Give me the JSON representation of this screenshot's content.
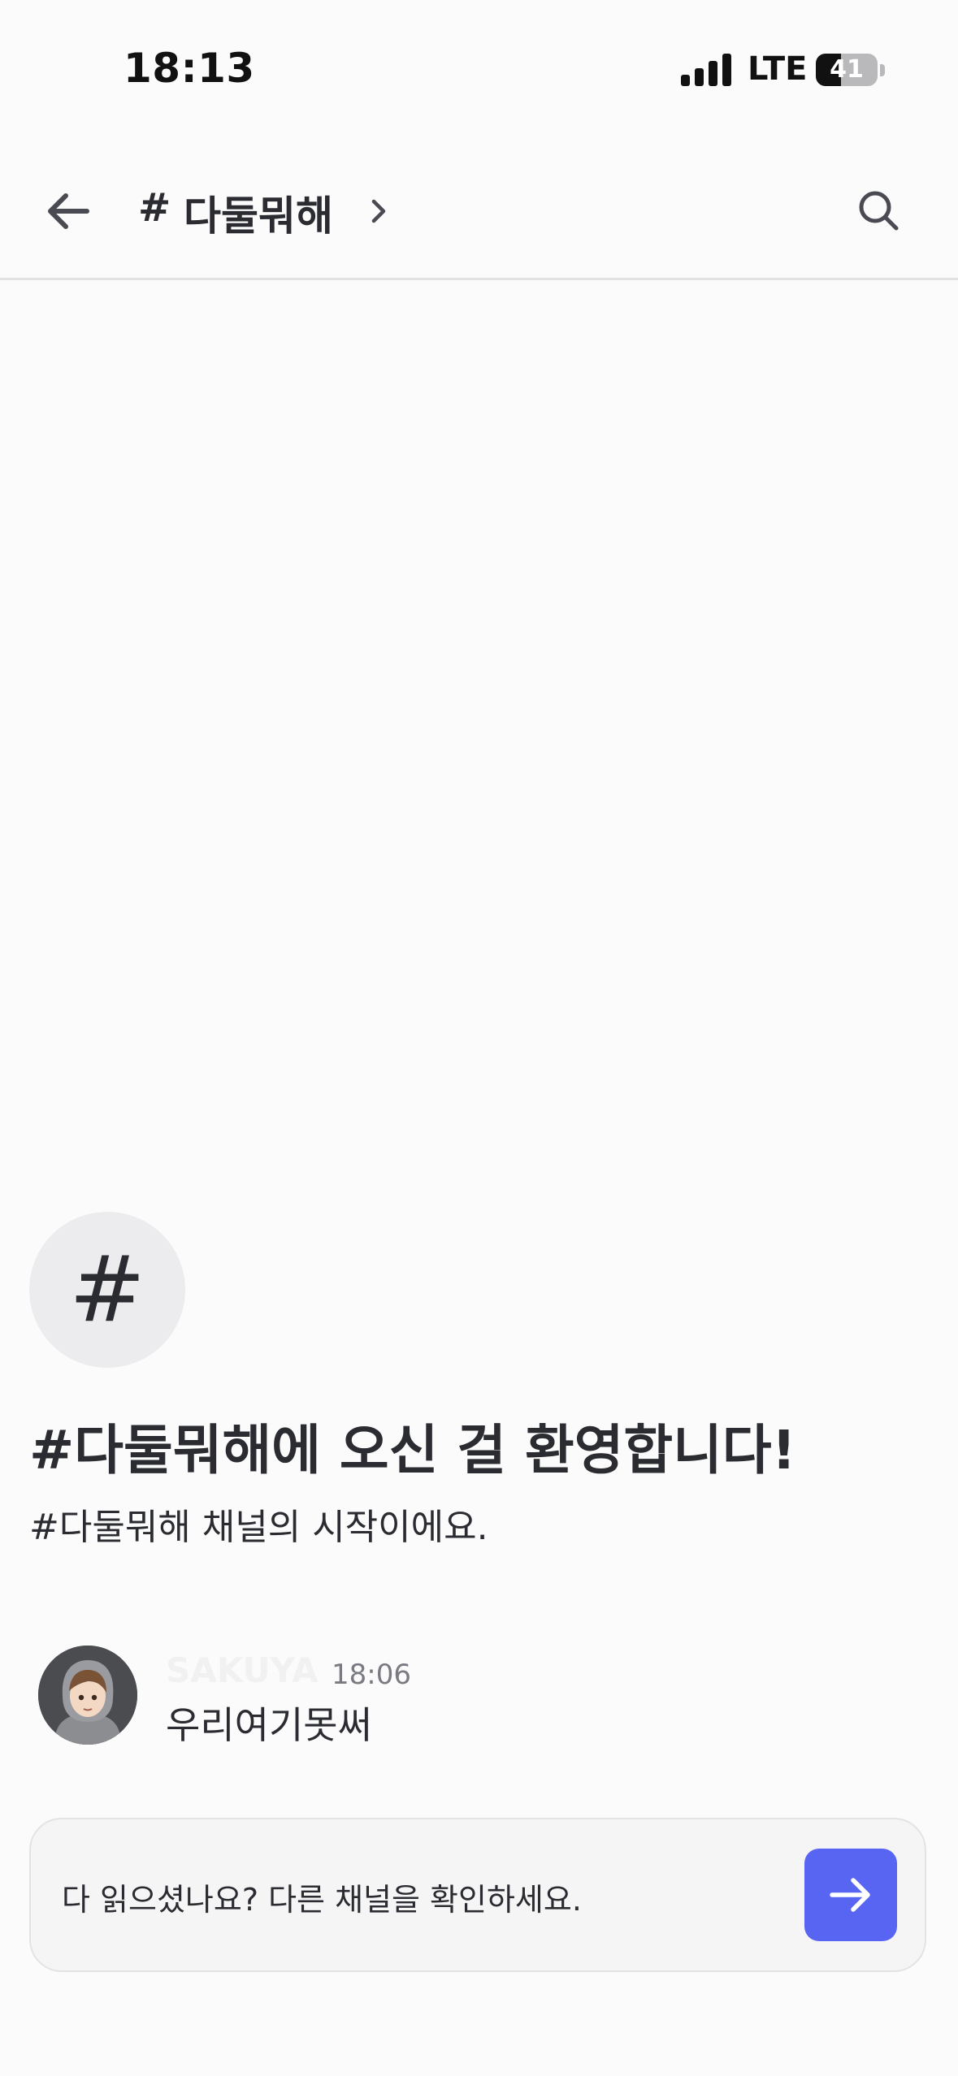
{
  "status_bar": {
    "time": "18:13",
    "network": "LTE",
    "battery": "41",
    "battery_level": 0.41
  },
  "header": {
    "hash": "#",
    "channel_name": "다둘뭐해",
    "back_icon": "arrow-left-icon",
    "chevron_icon": "chevron-right-icon",
    "search_icon": "search-icon"
  },
  "intro": {
    "hash_glyph": "#",
    "title": "#다둘뭐해에 오신 걸 환영합니다!",
    "subtitle": "#다둘뭐해 채널의 시작이에요."
  },
  "messages": [
    {
      "author": "SAKUYA",
      "time": "18:06",
      "text": "우리여기못써"
    }
  ],
  "bottom_bar": {
    "text": "다 읽으셨나요? 다른 채널을 확인하세요.",
    "button_icon": "arrow-right-icon"
  },
  "colors": {
    "background": "#fbfbfb",
    "accent": "#5865f2",
    "text": "#2b2c31",
    "muted": "#7a7b82",
    "divider": "#e2e2e5"
  }
}
